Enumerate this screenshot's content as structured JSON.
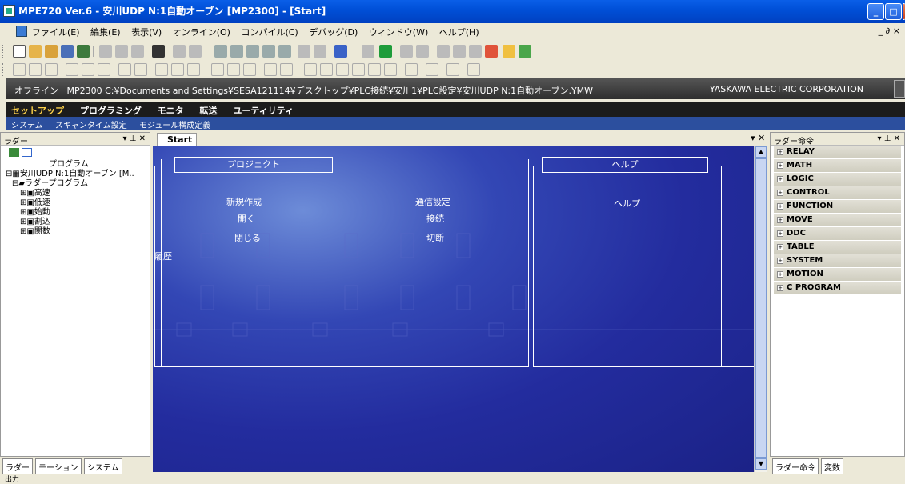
{
  "window": {
    "title": "MPE720 Ver.6 - 安川UDP N:1自動オーブン [MP2300] - [Start]",
    "minimize": "_",
    "maximize": "□",
    "close": "X"
  },
  "menu": {
    "items": [
      "ファイル(E)",
      "編集(E)",
      "表示(V)",
      "オンライン(O)",
      "コンパイル(C)",
      "デバッグ(D)",
      "ウィンドウ(W)",
      "ヘルプ(H)"
    ],
    "mdi_controls": "_ ∂ ×"
  },
  "pathbar": {
    "status": "オフライン",
    "project_type": "MP2300",
    "path": "C:¥Documents and Settings¥SESA121114¥デスクトップ¥PLC接続¥安川1¥PLC設定¥安川UDP N:1自動オーブン.YMW",
    "company": "YASKAWA ELECTRIC CORPORATION"
  },
  "mode_tabs": [
    "セットアップ",
    "プログラミング",
    "モニタ",
    "転送",
    "ユーティリティ"
  ],
  "sub_tabs": [
    "システム",
    "スキャンタイム設定",
    "モジュール構成定義"
  ],
  "left_panel": {
    "title": "ラダー",
    "controls": "▾ ⊥ ✕",
    "tree_header": "プログラム",
    "root": "安川UDP N:1自動オーブン [M..",
    "ladder": "ラダープログラム",
    "items": [
      "高速",
      "低速",
      "始動",
      "割込",
      "関数"
    ],
    "tabs": [
      "ラダー",
      "モーション",
      "システム"
    ]
  },
  "document": {
    "tab": "Start",
    "controls": "▾ ✕",
    "project_title": "プロジェクト",
    "help_title": "ヘルプ",
    "links": {
      "new": "新規作成",
      "open": "開く",
      "close": "閉じる",
      "comm": "通信設定",
      "connect": "接続",
      "disconnect": "切断",
      "help": "ヘルプ"
    },
    "history": "履歴"
  },
  "right_panel": {
    "title": "ラダー命令",
    "controls": "▾ ⊥ ✕",
    "categories": [
      "RELAY",
      "MATH",
      "LOGIC",
      "CONTROL",
      "FUNCTION",
      "MOVE",
      "DDC",
      "TABLE",
      "SYSTEM",
      "MOTION",
      "C PROGRAM"
    ],
    "tabs": [
      "ラダー命令",
      "変数"
    ]
  },
  "output": {
    "label": "出力"
  },
  "colors": {
    "title": "#0050d8",
    "canvas": "#232c9e",
    "path_bar": "#3a3a3a",
    "mode_bar": "#1c1c1c",
    "sub_bar": "#2c4f9e",
    "active_mode": "#ffd34a"
  }
}
